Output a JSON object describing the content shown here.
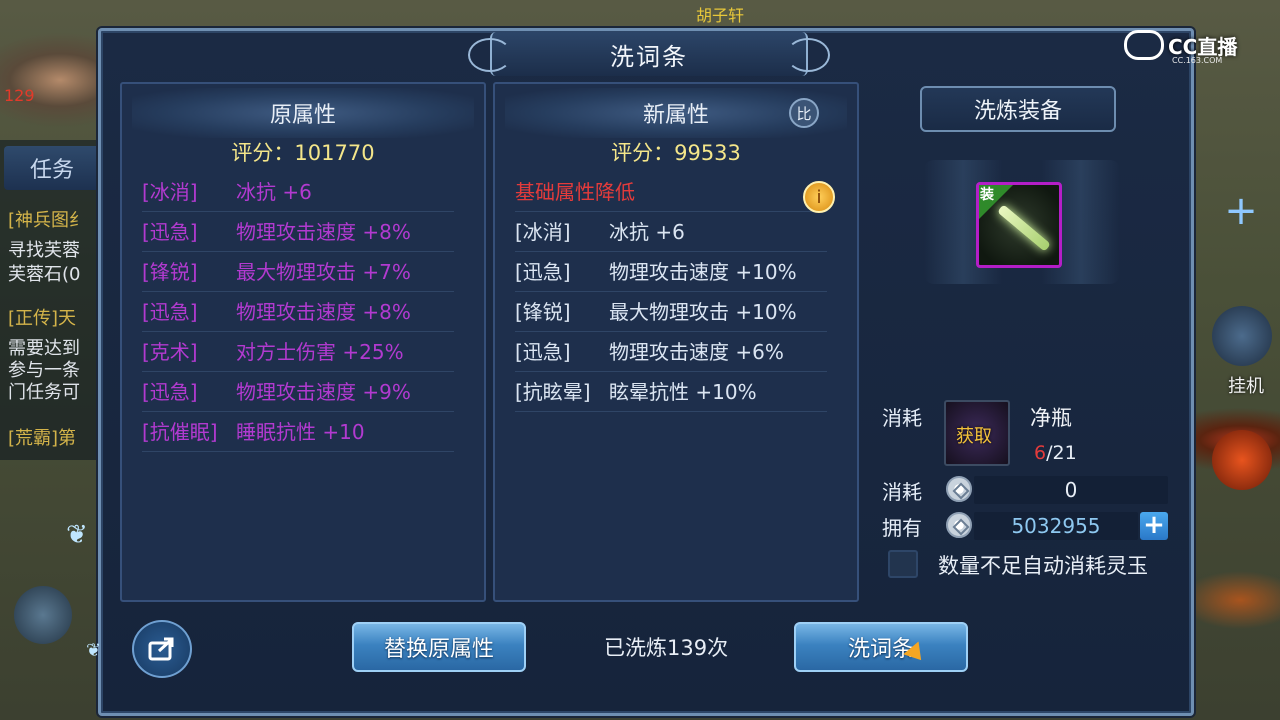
{
  "background": {
    "left_texts": [
      {
        "text": "[神兵图纟",
        "color": "#d4b44a"
      },
      {
        "text": "寻找芙蓉",
        "color": "#e0e4ea"
      },
      {
        "text": "芙蓉石(0",
        "color": "#e0e4ea"
      },
      {
        "text": "[正传]天",
        "color": "#d4b44a"
      },
      {
        "text": "需要达到",
        "color": "#e0e4ea"
      },
      {
        "text": "参与一条",
        "color": "#e0e4ea"
      },
      {
        "text": "门任务可",
        "color": "#e0e4ea"
      },
      {
        "text": "[荒霸]第",
        "color": "#d4b44a"
      }
    ],
    "task_tab": "任务",
    "level_badge": "129",
    "top_name": "胡子轩",
    "hang_label": "挂机"
  },
  "dialog": {
    "title": "洗词条"
  },
  "original": {
    "header": "原属性",
    "score": "评分：101770",
    "rows": [
      {
        "tag": "[冰消]",
        "value": "冰抗 +6",
        "color": "purple"
      },
      {
        "tag": "[迅急]",
        "value": "物理攻击速度 +8%",
        "color": "purple"
      },
      {
        "tag": "[锋锐]",
        "value": "最大物理攻击 +7%",
        "color": "purple"
      },
      {
        "tag": "[迅急]",
        "value": "物理攻击速度 +8%",
        "color": "purple"
      },
      {
        "tag": "[克术]",
        "value": "对方士伤害 +25%",
        "color": "purple"
      },
      {
        "tag": "[迅急]",
        "value": "物理攻击速度 +9%",
        "color": "purple"
      },
      {
        "tag": "[抗催眠]",
        "value": "睡眠抗性 +10",
        "color": "purple"
      }
    ]
  },
  "new": {
    "header": "新属性",
    "compare_label": "比",
    "score": "评分：99533",
    "warning": "基础属性降低",
    "warning_icon_label": "i",
    "rows": [
      {
        "tag": "[冰消]",
        "value": "冰抗 +6",
        "color": "light"
      },
      {
        "tag": "[迅急]",
        "value": "物理攻击速度 +10%",
        "color": "light"
      },
      {
        "tag": "[锋锐]",
        "value": "最大物理攻击 +10%",
        "color": "light"
      },
      {
        "tag": "[迅急]",
        "value": "物理攻击速度 +6%",
        "color": "light"
      },
      {
        "tag": "[抗眩晕]",
        "value": "眩晕抗性 +10%",
        "color": "light"
      }
    ]
  },
  "forge": {
    "title": "洗炼装备",
    "equip_badge": "装",
    "cost_label": "消耗",
    "item_slot_label": "获取",
    "item_name": "净瓶",
    "item_have": "6",
    "item_need": "/21",
    "cost_label2": "消耗",
    "cost_value": "0",
    "own_label": "拥有",
    "own_value": "5032955",
    "add_label": "+",
    "auto_label": "数量不足自动消耗灵玉"
  },
  "footer": {
    "replace_button": "替换原属性",
    "wash_count": "已洗炼139次",
    "reroll_button": "洗词条"
  },
  "watermark": {
    "brand": "CC直播",
    "sub": "CC.163.COM"
  },
  "icons": [
    "share-icon",
    "coin-icon",
    "plus-icon",
    "compare-icon",
    "warning-icon",
    "butterfly-icon",
    "pointer-cursor-icon"
  ]
}
